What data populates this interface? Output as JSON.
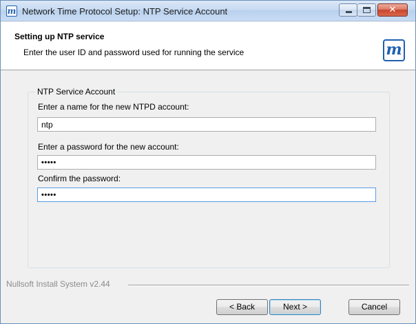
{
  "window": {
    "title": "Network Time Protocol Setup: NTP Service Account",
    "icon": "ntp-logo-icon",
    "controls": [
      "minimize-icon",
      "maximize-icon",
      "close-icon"
    ],
    "close_glyph": "✕"
  },
  "header": {
    "title": "Setting up NTP service",
    "subtitle": "Enter the user ID and password used for running the service",
    "logo_glyph": "m"
  },
  "group": {
    "label": "NTP Service Account",
    "name_label": "Enter a name for the new NTPD account:",
    "name_value": "ntp",
    "password_label": "Enter a password for the new account:",
    "password_value": "•••••",
    "confirm_label": "Confirm the password:",
    "confirm_value": "•••••"
  },
  "footer": {
    "brand": "Nullsoft Install System v2.44",
    "back_label": "< Back",
    "next_label": "Next >",
    "cancel_label": "Cancel"
  },
  "colors": {
    "accent": "#1f5fb1",
    "focus_border": "#569de5",
    "close_button": "#c8432b"
  }
}
